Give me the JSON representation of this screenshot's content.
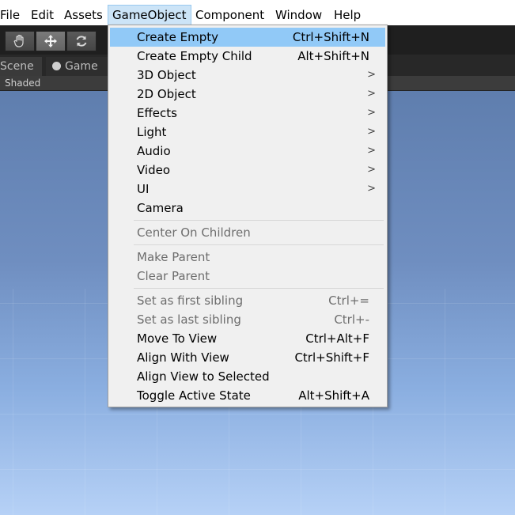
{
  "menubar": {
    "items": [
      "File",
      "Edit",
      "Assets",
      "GameObject",
      "Component",
      "Window",
      "Help"
    ],
    "active": "GameObject"
  },
  "toolbar": {
    "tools": [
      {
        "icon": "hand-icon",
        "selected": false
      },
      {
        "icon": "move-icon",
        "selected": true
      },
      {
        "icon": "rotate-icon",
        "selected": false
      }
    ]
  },
  "tabs": {
    "scene": "Scene",
    "game": "Game"
  },
  "scene_view": {
    "draw_mode": "Shaded"
  },
  "menu": {
    "items": [
      {
        "label": "Create Empty",
        "shortcut": "Ctrl+Shift+N",
        "highlighted": true
      },
      {
        "label": "Create Empty Child",
        "shortcut": "Alt+Shift+N"
      },
      {
        "label": "3D Object",
        "submenu": true
      },
      {
        "label": "2D Object",
        "submenu": true
      },
      {
        "label": "Effects",
        "submenu": true
      },
      {
        "label": "Light",
        "submenu": true
      },
      {
        "label": "Audio",
        "submenu": true
      },
      {
        "label": "Video",
        "submenu": true
      },
      {
        "label": "UI",
        "submenu": true
      },
      {
        "label": "Camera"
      },
      {
        "label": "Center On Children",
        "disabled": true
      },
      {
        "label": "Make Parent",
        "disabled": true
      },
      {
        "label": "Clear Parent",
        "disabled": true
      },
      {
        "label": "Set as first sibling",
        "shortcut": "Ctrl+=",
        "disabled": true
      },
      {
        "label": "Set as last sibling",
        "shortcut": "Ctrl+-",
        "disabled": true
      },
      {
        "label": "Move To View",
        "shortcut": "Ctrl+Alt+F"
      },
      {
        "label": "Align With View",
        "shortcut": "Ctrl+Shift+F"
      },
      {
        "label": "Align View to Selected"
      },
      {
        "label": "Toggle Active State",
        "shortcut": "Alt+Shift+A"
      }
    ],
    "submenu_arrow": ">"
  },
  "colors": {
    "highlight": "#91c9f7",
    "menu_bg": "#f0f0f0",
    "disabled_text": "#6d6d6d",
    "sky_top": "#5f7eae",
    "sky_bottom": "#b6d1f6"
  }
}
